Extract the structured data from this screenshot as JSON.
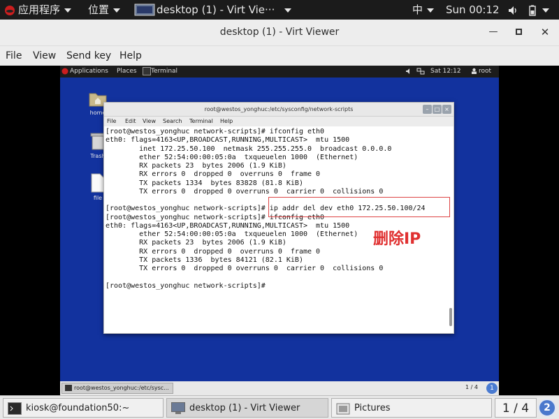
{
  "host_topbar": {
    "apps_label": "应用程序",
    "places_label": "位置",
    "task_label": "desktop (1) - Virt Vie···",
    "input_method": "中",
    "clock": "Sun 00:12"
  },
  "window": {
    "title": "desktop (1) - Virt Viewer",
    "menu": [
      "File",
      "View",
      "Send key",
      "Help"
    ]
  },
  "guest": {
    "topbar": {
      "applications": "Applications",
      "places": "Places",
      "terminal": "Terminal",
      "clock": "Sat 12:12",
      "user": "root"
    },
    "desktop_icons": [
      "home",
      "Trash",
      "file"
    ],
    "terminal": {
      "title": "root@westos_yonghuc:/etc/sysconfig/network-scripts",
      "menu": [
        "File",
        "Edit",
        "View",
        "Search",
        "Terminal",
        "Help"
      ],
      "content": "[root@westos_yonghuc network-scripts]# ifconfig eth0\neth0: flags=4163<UP,BROADCAST,RUNNING,MULTICAST>  mtu 1500\n        inet 172.25.50.100  netmask 255.255.255.0  broadcast 0.0.0.0\n        ether 52:54:00:00:05:0a  txqueuelen 1000  (Ethernet)\n        RX packets 23  bytes 2006 (1.9 KiB)\n        RX errors 0  dropped 0  overruns 0  frame 0\n        TX packets 1334  bytes 83828 (81.8 KiB)\n        TX errors 0  dropped 0 overruns 0  carrier 0  collisions 0\n\n[root@westos_yonghuc network-scripts]# ip addr del dev eth0 172.25.50.100/24\n[root@westos_yonghuc network-scripts]# ifconfig eth0\neth0: flags=4163<UP,BROADCAST,RUNNING,MULTICAST>  mtu 1500\n        ether 52:54:00:00:05:0a  txqueuelen 1000  (Ethernet)\n        RX packets 23  bytes 2006 (1.9 KiB)\n        RX errors 0  dropped 0  overruns 0  frame 0\n        TX packets 1336  bytes 84121 (82.1 KiB)\n        TX errors 0  dropped 0 overruns 0  carrier 0  collisions 0\n\n[root@westos_yonghuc network-scripts]#"
    },
    "annotation": "删除IP",
    "taskbar": {
      "task": "root@westos_yonghuc:/etc/sysc...",
      "pager": "1 / 4",
      "badge": "1"
    }
  },
  "host_bottom": {
    "tasks": [
      "kiosk@foundation50:~",
      "desktop (1) - Virt Viewer",
      "Pictures"
    ],
    "pager": "1 / 4",
    "badge": "2"
  },
  "colors": {
    "guest_desktop": "#12329e",
    "annotation": "#e03030"
  }
}
